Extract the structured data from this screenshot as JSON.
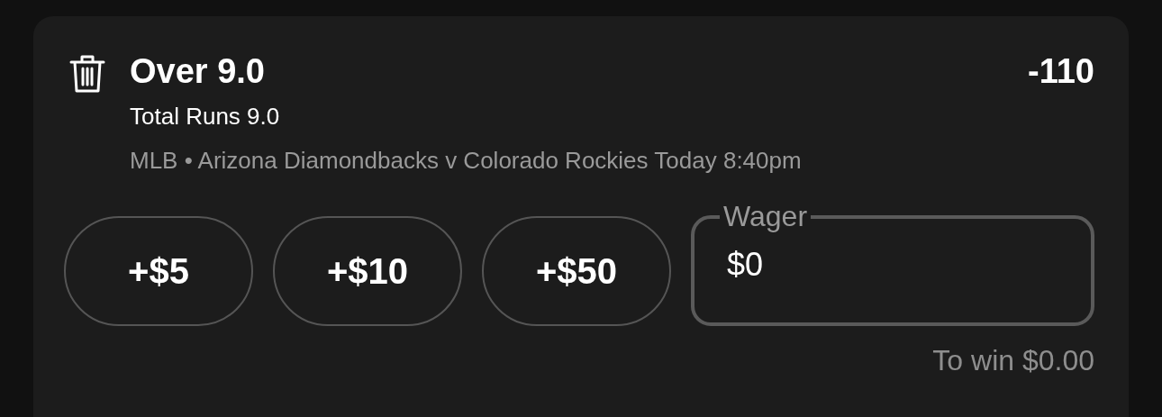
{
  "bet": {
    "selection": "Over 9.0",
    "odds": "-110",
    "market": "Total Runs 9.0",
    "event": "MLB • Arizona Diamondbacks v Colorado Rockies Today 8:40pm"
  },
  "quick_stakes": [
    {
      "label": "+$5"
    },
    {
      "label": "+$10"
    },
    {
      "label": "+$50"
    }
  ],
  "wager": {
    "label": "Wager",
    "value": "$0"
  },
  "to_win": "To win $0.00"
}
